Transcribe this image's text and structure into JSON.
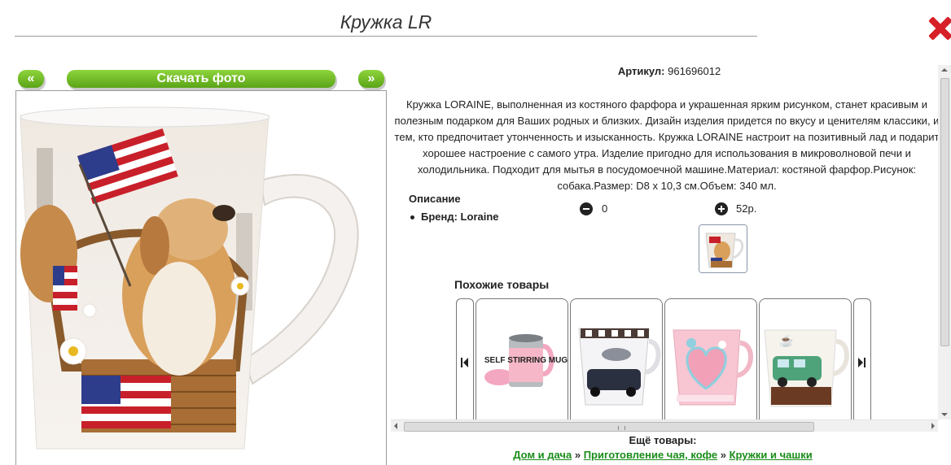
{
  "header": {
    "title": "Кружка LR"
  },
  "photo_nav": {
    "prev": "«",
    "download": "Скачать фото",
    "next": "»"
  },
  "product": {
    "article_label": "Артикул:",
    "article_value": "961696012",
    "description": "Кружка LORAINE, выполненная из костяного фарфора и украшенная ярким рисунком, станет красивым и полезным подарком для Ваших родных и близких. Дизайн изделия придется по вкусу и ценителям классики, и тем, кто предпочитает утонченность и изысканность. Кружка LORAINE настроит на позитивный лад и подарит хорошее настроение с самого утра. Изделие пригодно для использования в микроволновой печи и холодильника. Подходит для мытья в посудомоечной машине.Материал: костяной фарфор.Рисунок: собака.Размер: D8 x 10,3 см.Объем: 340 мл.",
    "specs_title": "Описание",
    "brand_line": "Бренд: Loraine",
    "quantity": "0",
    "price": "52р."
  },
  "similar": {
    "title": "Похожие товары",
    "items": [
      {
        "image": "self-stirring-mug",
        "caption": "SELF STIRRING MUG"
      },
      {
        "image": "car-print-mug"
      },
      {
        "image": "pink-heart-mug"
      },
      {
        "image": "green-van-mug"
      }
    ]
  },
  "more": {
    "title": "Ещё товары:",
    "crumb_1": "Дом и дача",
    "sep": "»",
    "crumb_2": "Приготовление чая, кофе",
    "crumb_3": "Кружки и чашки"
  },
  "colors": {
    "accent_green": "#6ab923",
    "link_green": "#1a8c1a",
    "close_red": "#d61f26"
  }
}
